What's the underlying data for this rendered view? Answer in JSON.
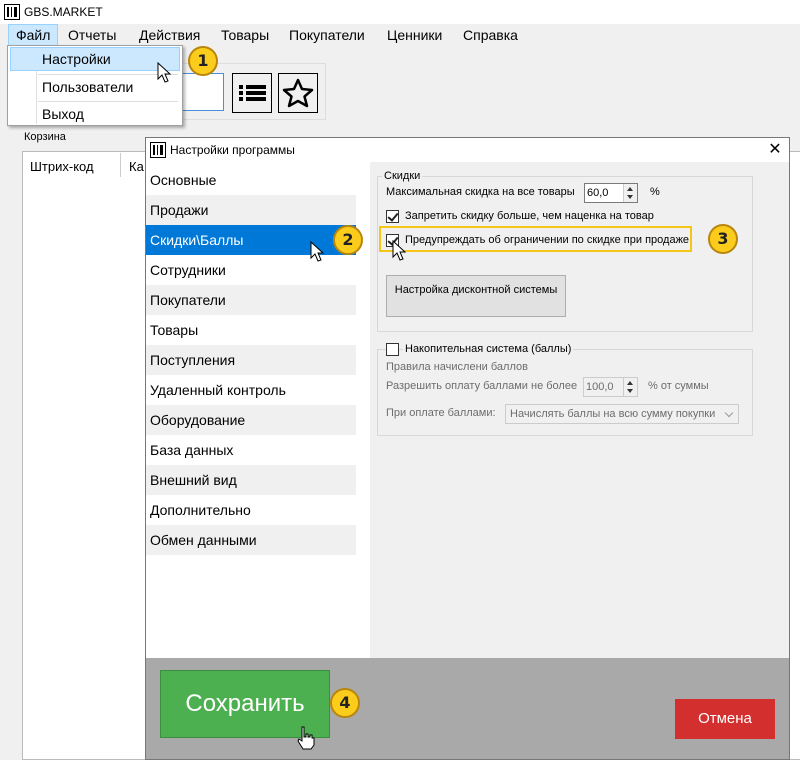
{
  "app": {
    "title": "GBS.MARKET"
  },
  "menu": [
    "Файл",
    "Отчеты",
    "Действия",
    "Товары",
    "Покупатели",
    "Ценники",
    "Справка"
  ],
  "file_menu": [
    "Настройки",
    "Пользователи",
    "Выход"
  ],
  "cart": {
    "label": "Корзина",
    "columns": [
      "Штрих-код",
      "Ка"
    ]
  },
  "dialog": {
    "title": "Настройки программы",
    "close": "✕",
    "nav": [
      "Основные",
      "Продажи",
      "Скидки\\Баллы",
      "Сотрудники",
      "Покупатели",
      "Товары",
      "Поступления",
      "Удаленный контроль",
      "Оборудование",
      "База данных",
      "Внешний вид",
      "Дополнительно",
      "Обмен данными"
    ],
    "selected_nav": "Скидки\\Баллы",
    "discounts": {
      "group_title": "Скидки",
      "max_discount_label": "Максимальная скидка на все товары",
      "max_discount_value": "60,0",
      "percent": "%",
      "forbid_label": "Запретить скидку больше, чем наценка на товар",
      "forbid_checked": true,
      "warn_label": "Предупреждать об ограничении по скидке при продаже",
      "warn_checked": true,
      "discount_system_button": "Настройка дисконтной системы"
    },
    "points": {
      "group_title": "Накопительная система (баллы)",
      "enabled": false,
      "rules_label": "Правила начислени баллов",
      "allow_label": "Разрешить оплату баллами не более",
      "allow_value": "100,0",
      "allow_unit": "% от суммы",
      "pay_label": "При оплате баллами:",
      "pay_option": "Начислять баллы на всю сумму покупки"
    },
    "save": "Сохранить",
    "cancel": "Отмена"
  },
  "badges": [
    "1",
    "2",
    "3",
    "4"
  ],
  "colors": {
    "selection": "#0078d7",
    "save": "#4caf50",
    "cancel": "#d32f2f",
    "badge": "#fccc1d",
    "highlight": "#f5c518"
  }
}
